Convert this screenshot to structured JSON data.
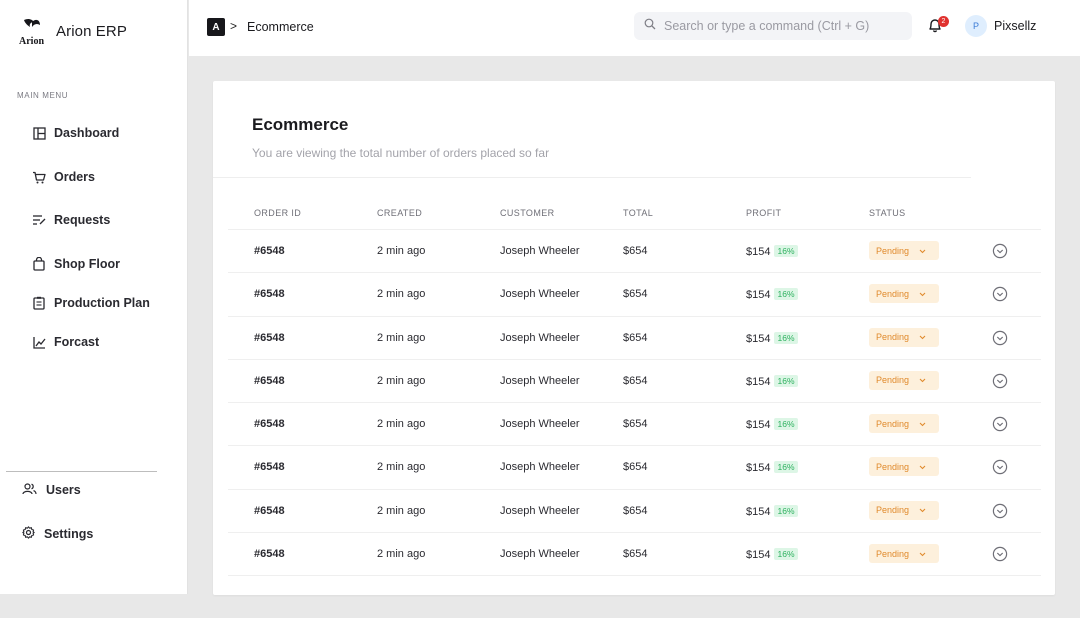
{
  "app": {
    "name": "Arion ERP",
    "logo_text": "Arion"
  },
  "sidebar": {
    "heading": "MAIN MENU",
    "items": [
      {
        "label": "Dashboard",
        "icon": "dashboard-icon"
      },
      {
        "label": "Orders",
        "icon": "cart-icon"
      },
      {
        "label": "Requests",
        "icon": "requests-icon"
      },
      {
        "label": "Shop Floor",
        "icon": "bag-icon"
      },
      {
        "label": "Production Plan",
        "icon": "clipboard-icon"
      },
      {
        "label": "Forcast",
        "icon": "chart-line-icon"
      }
    ],
    "bottom": [
      {
        "label": "Users",
        "icon": "users-icon"
      },
      {
        "label": "Settings",
        "icon": "gear-icon"
      }
    ]
  },
  "topbar": {
    "breadcrumb_badge": "A",
    "breadcrumb_separator": ">",
    "breadcrumb_page": "Ecommerce",
    "search_placeholder": "Search or type a command (Ctrl + G)",
    "notification_count": "2",
    "user_initial": "P",
    "user_name": "Pixsellz"
  },
  "main": {
    "title": "Ecommerce",
    "subtitle": "You are viewing the total number of orders placed so far",
    "columns": [
      "ORDER ID",
      "CREATED",
      "CUSTOMER",
      "TOTAL",
      "PROFIT",
      "STATUS"
    ],
    "rows": [
      {
        "order_id": "#6548",
        "created": "2 min ago",
        "customer": "Joseph Wheeler",
        "total": "$654",
        "profit": "$154",
        "profit_pct": "16%",
        "status": "Pending"
      },
      {
        "order_id": "#6548",
        "created": "2 min ago",
        "customer": "Joseph Wheeler",
        "total": "$654",
        "profit": "$154",
        "profit_pct": "16%",
        "status": "Pending"
      },
      {
        "order_id": "#6548",
        "created": "2 min ago",
        "customer": "Joseph Wheeler",
        "total": "$654",
        "profit": "$154",
        "profit_pct": "16%",
        "status": "Pending"
      },
      {
        "order_id": "#6548",
        "created": "2 min ago",
        "customer": "Joseph Wheeler",
        "total": "$654",
        "profit": "$154",
        "profit_pct": "16%",
        "status": "Pending"
      },
      {
        "order_id": "#6548",
        "created": "2 min ago",
        "customer": "Joseph Wheeler",
        "total": "$654",
        "profit": "$154",
        "profit_pct": "16%",
        "status": "Pending"
      },
      {
        "order_id": "#6548",
        "created": "2 min ago",
        "customer": "Joseph Wheeler",
        "total": "$654",
        "profit": "$154",
        "profit_pct": "16%",
        "status": "Pending"
      },
      {
        "order_id": "#6548",
        "created": "2 min ago",
        "customer": "Joseph Wheeler",
        "total": "$654",
        "profit": "$154",
        "profit_pct": "16%",
        "status": "Pending"
      },
      {
        "order_id": "#6548",
        "created": "2 min ago",
        "customer": "Joseph Wheeler",
        "total": "$654",
        "profit": "$154",
        "profit_pct": "16%",
        "status": "Pending"
      }
    ]
  },
  "colors": {
    "status_pending_bg": "#fdf0dc",
    "status_pending_text": "#e08a2c",
    "profit_badge_bg": "#ddf6e6",
    "profit_badge_text": "#2cb05e",
    "notification": "#e0322f"
  }
}
